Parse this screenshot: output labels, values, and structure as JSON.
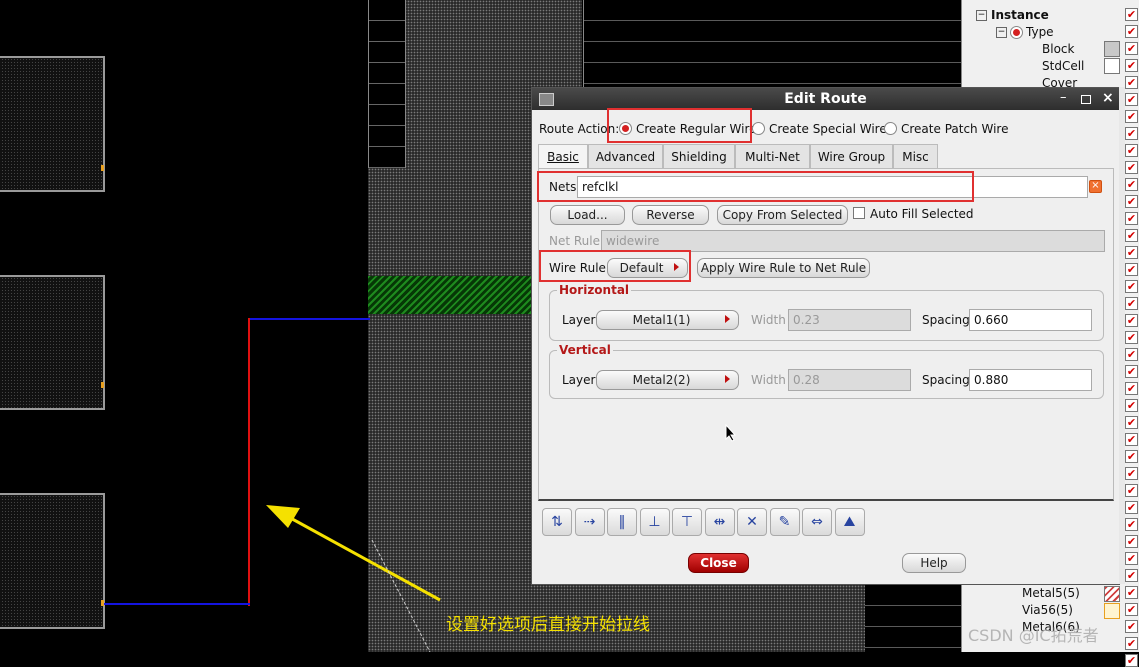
{
  "tree": {
    "items": [
      {
        "label": "Instance",
        "bold": true,
        "checked": true
      },
      {
        "label": "Type",
        "checked": true
      },
      {
        "label": "Block",
        "checked": true
      },
      {
        "label": "StdCell",
        "checked": true
      },
      {
        "label": "Cover",
        "checked": true
      }
    ],
    "bottom_items": [
      {
        "label": "Metal5(5)",
        "checked": true
      },
      {
        "label": "Via56(5)",
        "checked": true
      },
      {
        "label": "Metal6(6)",
        "checked": true
      }
    ]
  },
  "dialog": {
    "title": "Edit Route",
    "route_action_label": "Route Action:",
    "route_actions": [
      {
        "label": "Create Regular Wire",
        "selected": true
      },
      {
        "label": "Create Special Wire",
        "selected": false
      },
      {
        "label": "Create Patch Wire",
        "selected": false
      }
    ],
    "tabs": [
      "Basic",
      "Advanced",
      "Shielding",
      "Multi-Net",
      "Wire Group",
      "Misc"
    ],
    "active_tab": "Basic",
    "nets_label": "Nets",
    "nets_value": "refclkl",
    "load_button": "Load...",
    "reverse_button": "Reverse",
    "copy_button": "Copy From Selected",
    "auto_fill_label": "Auto Fill Selected",
    "auto_fill_checked": false,
    "net_rule_label": "Net Rule",
    "net_rule_value": "widewire",
    "wire_rule_label": "Wire Rule",
    "wire_rule_value": "Default",
    "apply_button": "Apply Wire Rule to Net Rule",
    "horizontal": {
      "title": "Horizontal",
      "layer_label": "Layer",
      "layer": "Metal1(1)",
      "width_label": "Width",
      "width": "0.23",
      "spacing_label": "Spacing",
      "spacing": "0.660"
    },
    "vertical": {
      "title": "Vertical",
      "layer_label": "Layer",
      "layer": "Metal2(2)",
      "width_label": "Width",
      "width": "0.28",
      "spacing_label": "Spacing",
      "spacing": "0.880"
    },
    "toolbar_icons": [
      "route-flip-icon",
      "split-icon",
      "vertical-wires-icon",
      "align-center-icon",
      "align-horizontal-icon",
      "bus-icon",
      "delete-segment-icon",
      "eraser-icon",
      "stretch-icon",
      "trim-icon"
    ],
    "close_button": "Close",
    "help_button": "Help"
  },
  "annotation": {
    "text": "设置好选项后直接开始拉线",
    "color": "#f5e100"
  },
  "watermark": "CSDN @IC拓荒者",
  "colors": {
    "highlight_box": "#e03030",
    "route_red": "#e01010",
    "route_blue": "#1414e0",
    "group_title": "#b41818"
  }
}
